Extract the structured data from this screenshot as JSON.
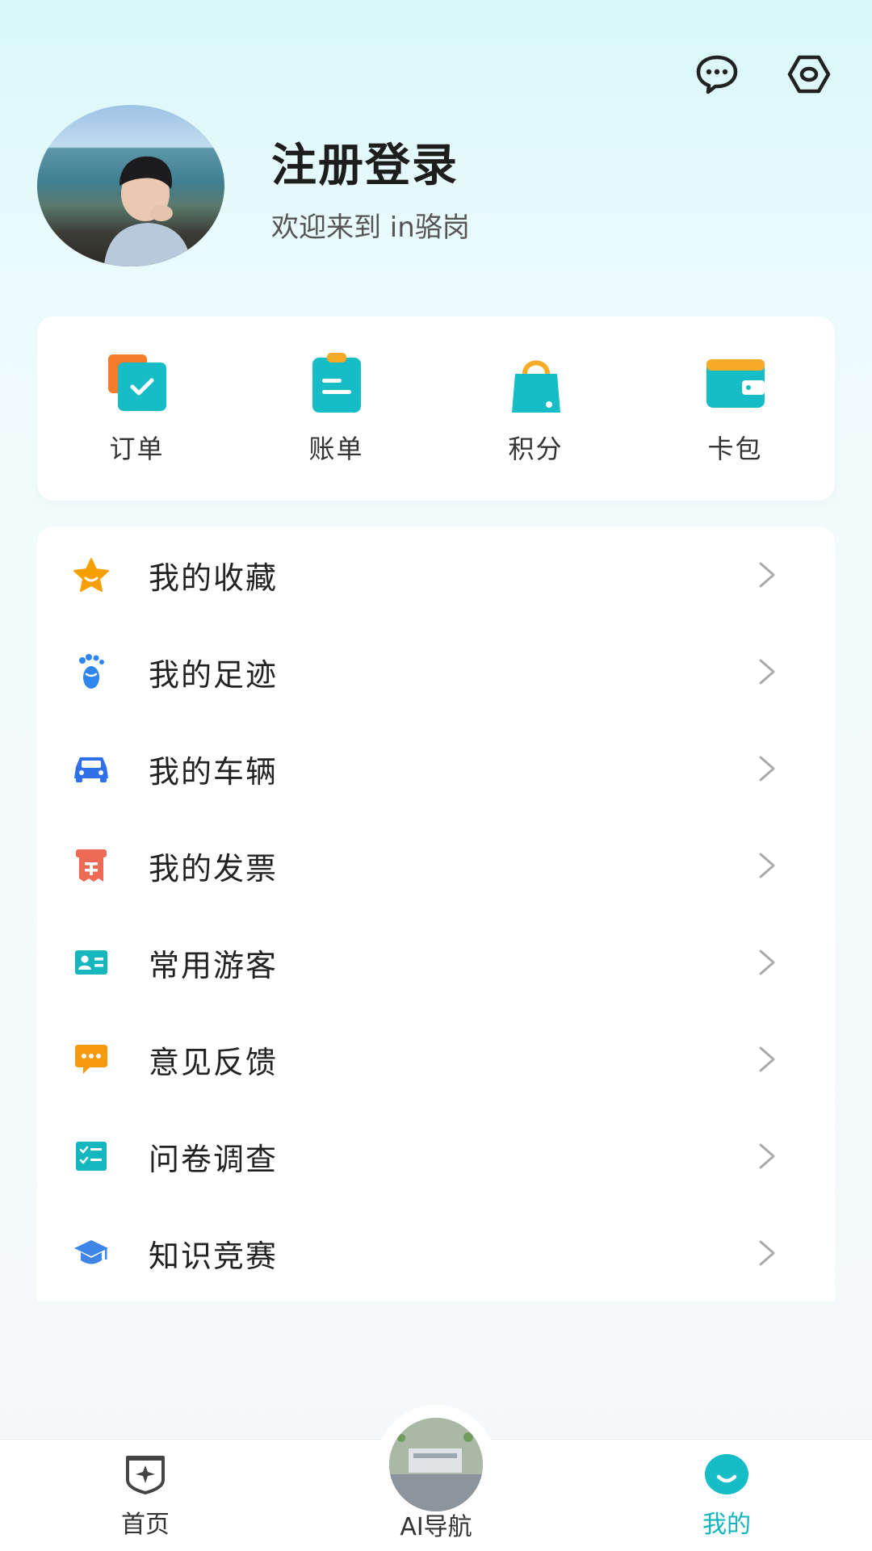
{
  "header": {
    "icons": [
      "message-icon",
      "settings-icon"
    ]
  },
  "profile": {
    "title": "注册登录",
    "subtitle": "欢迎来到 in骆岗"
  },
  "quick_actions": [
    {
      "label": "订单",
      "icon": "order-icon"
    },
    {
      "label": "账单",
      "icon": "bill-icon"
    },
    {
      "label": "积分",
      "icon": "points-bag-icon"
    },
    {
      "label": "卡包",
      "icon": "wallet-icon"
    }
  ],
  "menu": [
    {
      "label": "我的收藏",
      "icon": "star-icon",
      "color": "#f5a000"
    },
    {
      "label": "我的足迹",
      "icon": "footprint-icon",
      "color": "#2f86f0"
    },
    {
      "label": "我的车辆",
      "icon": "car-icon",
      "color": "#2f6fe8"
    },
    {
      "label": "我的发票",
      "icon": "invoice-icon",
      "color": "#ef6a55"
    },
    {
      "label": "常用游客",
      "icon": "id-card-icon",
      "color": "#14b7c0"
    },
    {
      "label": "意见反馈",
      "icon": "feedback-icon",
      "color": "#f59a0c"
    },
    {
      "label": "问卷调查",
      "icon": "survey-icon",
      "color": "#14b7c0"
    },
    {
      "label": "知识竞赛",
      "icon": "graduation-cap-icon",
      "color": "#3d86e8"
    }
  ],
  "tabbar": {
    "home": "首页",
    "ai": "AI导航",
    "mine": "我的",
    "active_color": "#13b4bd"
  },
  "colors": {
    "accent": "#16bcc6"
  }
}
